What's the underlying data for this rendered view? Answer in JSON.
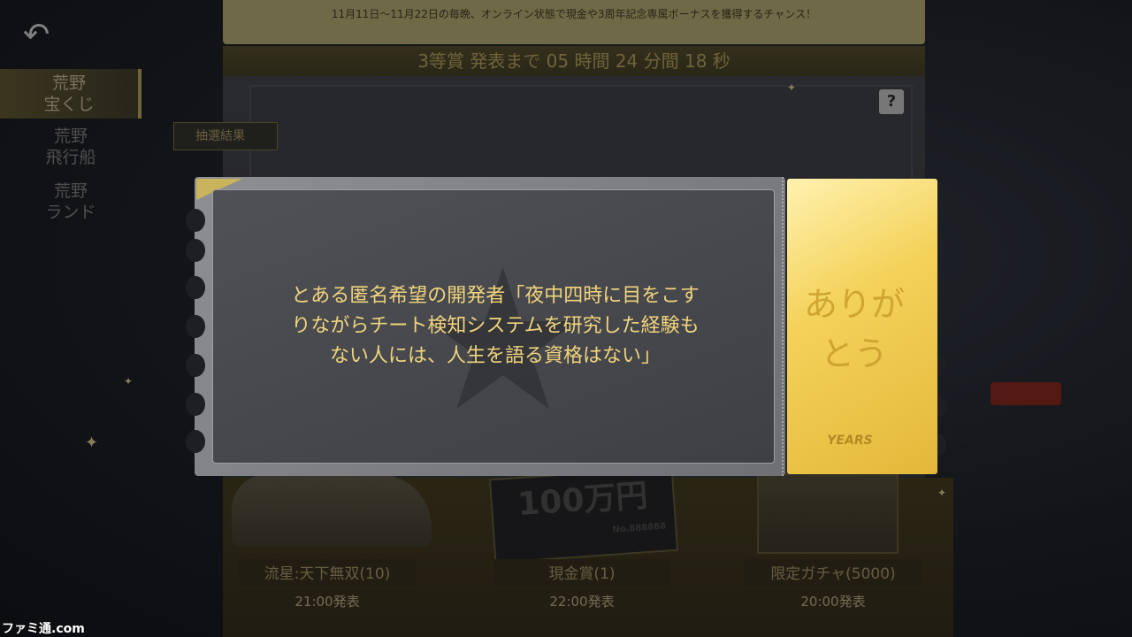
{
  "header": {
    "banner_text": "11月11日～11月22日の毎晩、オンライン状態で現金や3周年記念専属ボーナスを獲得するチャンス！",
    "countdown": "3等賞 発表まで 05 時間 24 分間 18 秒",
    "help_label": "?"
  },
  "sidebar": {
    "back_icon": "back-arrow-icon",
    "items": [
      {
        "label": "荒野\n宝くじ",
        "line1": "荒野",
        "line2": "宝くじ",
        "active": true
      },
      {
        "label": "荒野\n飛行船",
        "line1": "荒野",
        "line2": "飛行船",
        "active": false
      },
      {
        "label": "荒野\nランド",
        "line1": "荒野",
        "line2": "ランド",
        "active": false
      }
    ],
    "draw_results_label": "抽選結果"
  },
  "prizes": [
    {
      "name": "流星:天下無双(10)",
      "time": "21:00発表"
    },
    {
      "name": "現金賞(1)",
      "time": "22:00発表"
    },
    {
      "name": "限定ガチャ(5000)",
      "time": "20:00発表"
    }
  ],
  "prize_images": {
    "cash_sign": "100万円",
    "cash_serial": "No.888888"
  },
  "ticket": {
    "message_line1": "とある匿名希望の開発者「夜中四時に目をこす",
    "message_line2": "りながらチート検知システムを研究した経験も",
    "message_line3": "ない人には、人生を語る資格はない」",
    "stub_line1": "ありが",
    "stub_line2": "とう",
    "stub_logo": "YEARS"
  },
  "watermark": "ファミ通.com",
  "colors": {
    "message_text": "#f1d47c",
    "stub_gold": "#f4d25a",
    "accent_gold": "#c9b86c"
  }
}
